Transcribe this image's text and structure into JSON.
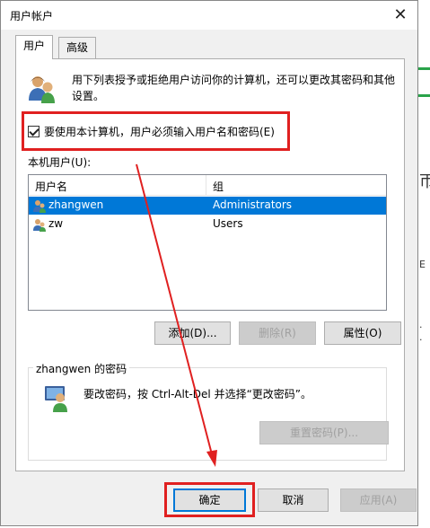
{
  "window": {
    "title": "用户帐户",
    "close_glyph": "✕"
  },
  "tabs": [
    {
      "label": "用户",
      "active": true
    },
    {
      "label": "高级",
      "active": false
    }
  ],
  "description": "用下列表授予或拒绝用户访问你的计算机，还可以更改其密码和其他设置。",
  "checkbox": {
    "label": "要使用本计算机，用户必须输入用户名和密码(E)",
    "checked": true
  },
  "local_users_label": "本机用户(U):",
  "users_table": {
    "headers": [
      "用户名",
      "组"
    ],
    "rows": [
      {
        "name": "zhangwen",
        "group": "Administrators",
        "selected": true
      },
      {
        "name": "zw",
        "group": "Users",
        "selected": false
      }
    ]
  },
  "user_buttons": {
    "add": "添加(D)...",
    "remove": "删除(R)",
    "properties": "属性(O)"
  },
  "password_group": {
    "title": "zhangwen 的密码",
    "text": "要改密码，按 Ctrl-Alt-Del 并选择“更改密码”。",
    "reset_button": "重置密码(P)..."
  },
  "footer_buttons": {
    "ok": "确定",
    "cancel": "取消",
    "apply": "应用(A)"
  },
  "background_glyphs": [
    "帀",
    "E",
    "·",
    "·"
  ],
  "colors": {
    "annotation_red": "#e02020",
    "selection_blue": "#0078d7"
  },
  "icons": [
    "users-icon",
    "user-icon",
    "password-user-icon",
    "close-icon",
    "checkmark-icon"
  ]
}
